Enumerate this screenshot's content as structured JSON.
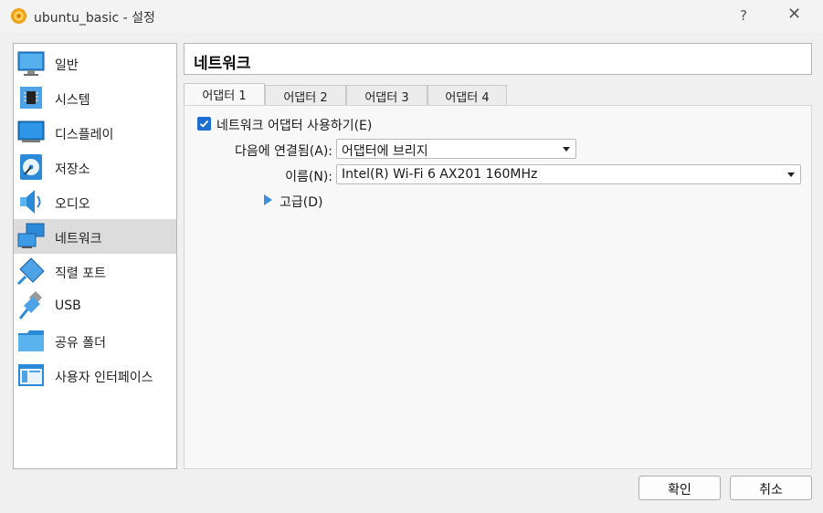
{
  "window": {
    "title": "ubuntu_basic - 설정",
    "help_label": "?",
    "close_label": "✕"
  },
  "sidebar": {
    "items": [
      {
        "label": "일반",
        "icon": "general-icon"
      },
      {
        "label": "시스템",
        "icon": "system-icon"
      },
      {
        "label": "디스플레이",
        "icon": "display-icon"
      },
      {
        "label": "저장소",
        "icon": "storage-icon"
      },
      {
        "label": "오디오",
        "icon": "audio-icon"
      },
      {
        "label": "네트워크",
        "icon": "network-icon"
      },
      {
        "label": "직렬 포트",
        "icon": "serial-port-icon"
      },
      {
        "label": "USB",
        "icon": "usb-icon"
      },
      {
        "label": "공유 폴더",
        "icon": "shared-folder-icon"
      },
      {
        "label": "사용자 인터페이스",
        "icon": "user-interface-icon"
      }
    ],
    "selected": "네트워크"
  },
  "main": {
    "section_title": "네트워크",
    "tabs": [
      {
        "label": "어댑터 1"
      },
      {
        "label": "어댑터 2"
      },
      {
        "label": "어댑터 3"
      },
      {
        "label": "어댑터 4"
      }
    ],
    "active_tab": "어댑터 1",
    "enable_adapter_label": "네트워크 어댑터 사용하기(E)",
    "enable_adapter_checked": true,
    "attached_to_label": "다음에 연결됨(A):",
    "attached_to_value": "어댑터에 브리지",
    "name_label": "이름(N):",
    "name_value": "Intel(R) Wi-Fi 6 AX201 160MHz",
    "advanced_label": "고급(D)"
  },
  "buttons": {
    "ok_label": "확인",
    "cancel_label": "취소"
  },
  "colors": {
    "accent": "#1c6fd1",
    "selected_bg": "#dcdcdc",
    "expander": "#3d8fe0"
  }
}
